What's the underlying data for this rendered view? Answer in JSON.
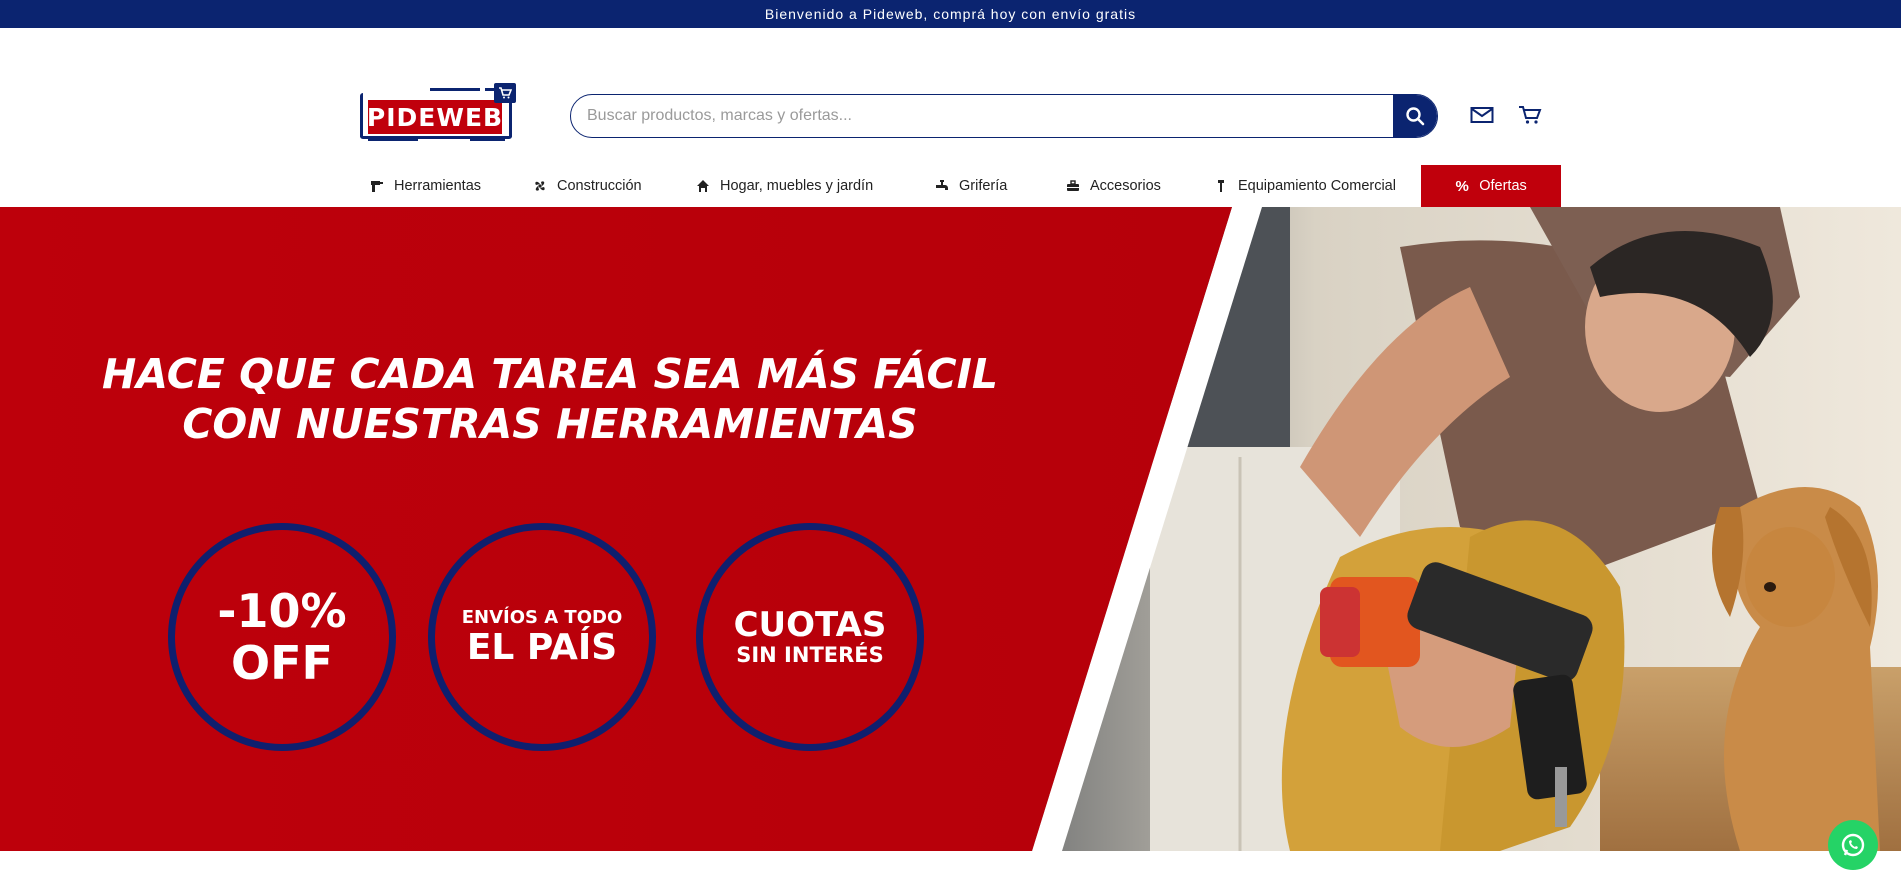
{
  "announcement": "Bienvenido a Pideweb, comprá hoy con envío gratis",
  "brand": {
    "logo_text": "PIDEWEB",
    "primary_color": "#0b2470",
    "accent_color": "#c0000c"
  },
  "search": {
    "placeholder": "Buscar productos, marcas y ofertas..."
  },
  "header_icons": [
    "mail-icon",
    "cart-icon"
  ],
  "nav": {
    "items": [
      {
        "label": "Herramientas",
        "icon": "drill-icon"
      },
      {
        "label": "Construcción",
        "icon": "fan-icon"
      },
      {
        "label": "Hogar, muebles y jardín",
        "icon": "home-icon"
      },
      {
        "label": "Grifería",
        "icon": "faucet-icon"
      },
      {
        "label": "Accesorios",
        "icon": "toolbox-icon"
      },
      {
        "label": "Equipamiento Comercial",
        "icon": "tool-icon"
      },
      {
        "label": "Ofertas",
        "icon": "percent-icon"
      }
    ]
  },
  "hero": {
    "headline_line1": "HACE QUE CADA TAREA SEA MÁS FÁCIL",
    "headline_line2": "CON NUESTRAS HERRAMIENTAS",
    "badges": [
      {
        "line1": "-10%",
        "line2": "OFF"
      },
      {
        "line1": "ENVÍOS A TODO",
        "line2": "EL PAÍS"
      },
      {
        "line1": "CUOTAS",
        "line2": "SIN INTERÉS"
      }
    ]
  },
  "whatsapp": {
    "icon": "whatsapp-icon"
  }
}
